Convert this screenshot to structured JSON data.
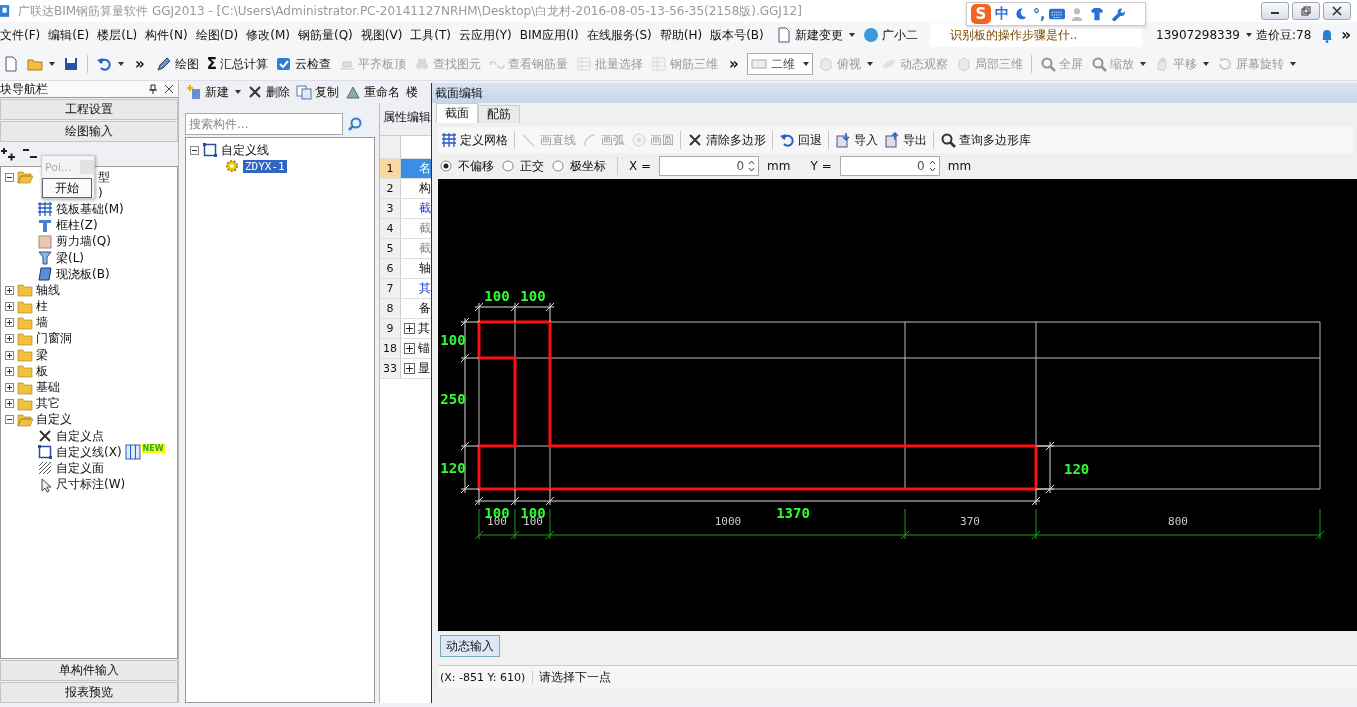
{
  "window": {
    "title": "广联达BIM钢筋算量软件 GGJ2013 - [C:\\Users\\Administrator.PC-20141127NRHM\\Desktop\\白龙村-2016-08-05-13-56-35(2158版).GGJ12]"
  },
  "ime": {
    "logo": "S",
    "lang": "中",
    "punct": "°,"
  },
  "menu": [
    "文件(F)",
    "编辑(E)",
    "楼层(L)",
    "构件(N)",
    "绘图(D)",
    "修改(M)",
    "钢筋量(Q)",
    "视图(V)",
    "工具(T)",
    "云应用(Y)",
    "BIM应用(I)",
    "在线服务(S)",
    "帮助(H)",
    "版本号(B)"
  ],
  "menu_extras": {
    "change": "新建变更",
    "assistant": "广小二",
    "hint": "识别板的操作步骤是什..",
    "phone": "13907298339",
    "beans": "造价豆:78",
    "more": "»"
  },
  "toolbar": [
    {
      "kind": "button",
      "disabled": false,
      "dropdown": false
    },
    {
      "kind": "button",
      "disabled": false,
      "dropdown": true
    },
    {
      "kind": "button",
      "disabled": false,
      "dropdown": false
    },
    {
      "kind": "separator"
    },
    {
      "kind": "button",
      "disabled": false,
      "dropdown": true
    },
    {
      "kind": "chevron",
      "label": "»"
    },
    {
      "kind": "button",
      "label": "绘图",
      "disabled": false,
      "dropdown": false
    },
    {
      "kind": "button",
      "glyph": "Σ",
      "label": "汇总计算",
      "disabled": false,
      "dropdown": false
    },
    {
      "kind": "button",
      "label": "云检查",
      "disabled": false,
      "dropdown": false
    },
    {
      "kind": "button",
      "label": "平齐板顶",
      "disabled": true,
      "dropdown": false
    },
    {
      "kind": "button",
      "label": "查找图元",
      "disabled": true,
      "dropdown": false
    },
    {
      "kind": "button",
      "label": "查看钢筋量",
      "disabled": true,
      "dropdown": false
    },
    {
      "kind": "button",
      "label": "批量选择",
      "disabled": true,
      "dropdown": false
    },
    {
      "kind": "button",
      "label": "钢筋三维",
      "disabled": true,
      "dropdown": false
    },
    {
      "kind": "chevron",
      "label": "»"
    },
    {
      "kind": "select",
      "label": "二维"
    },
    {
      "kind": "button",
      "label": "俯视",
      "disabled": true,
      "dropdown": true
    },
    {
      "kind": "button",
      "label": "动态观察",
      "disabled": true,
      "dropdown": false
    },
    {
      "kind": "button",
      "label": "局部三维",
      "disabled": true,
      "dropdown": false
    },
    {
      "kind": "separator"
    },
    {
      "kind": "button",
      "label": "全屏",
      "disabled": true,
      "dropdown": false
    },
    {
      "kind": "button",
      "label": "缩放",
      "disabled": true,
      "dropdown": true
    },
    {
      "kind": "button",
      "label": "平移",
      "disabled": true,
      "dropdown": true
    },
    {
      "kind": "button",
      "label": "屏幕旋转",
      "disabled": true,
      "dropdown": true
    }
  ],
  "nav": {
    "title": "块导航栏",
    "sections_top": [
      "工程设置",
      "绘图输入"
    ],
    "sections_bottom": [
      "单构件输入",
      "报表预览"
    ],
    "popup": {
      "title": "Poi...",
      "button": "开始"
    },
    "tree": [
      {
        "label": "型",
        "expanded": true,
        "children": [
          {
            "label": ")"
          },
          {
            "label": "筏板基础(M)"
          },
          {
            "label": "框柱(Z)"
          },
          {
            "label": "剪力墙(Q)"
          },
          {
            "label": "梁(L)"
          },
          {
            "label": "现浇板(B)"
          }
        ]
      },
      {
        "label": "轴线",
        "expanded": false
      },
      {
        "label": "柱",
        "expanded": false
      },
      {
        "label": "墙",
        "expanded": false
      },
      {
        "label": "门窗洞",
        "expanded": false
      },
      {
        "label": "梁",
        "expanded": false
      },
      {
        "label": "板",
        "expanded": false
      },
      {
        "label": "基础",
        "expanded": false
      },
      {
        "label": "其它",
        "expanded": false
      },
      {
        "label": "自定义",
        "expanded": true,
        "children": [
          {
            "label": "自定义点"
          },
          {
            "label": "自定义线(X)",
            "badge": "NEW"
          },
          {
            "label": "自定义面"
          },
          {
            "label": "尺寸标注(W)"
          }
        ]
      }
    ]
  },
  "components": {
    "toolbar": [
      {
        "label": "新建",
        "dropdown": true
      },
      {
        "label": "删除",
        "dropdown": false
      },
      {
        "label": "复制",
        "dropdown": false
      },
      {
        "label": "重命名",
        "dropdown": false
      },
      {
        "label": "楼",
        "dropdown": false
      }
    ],
    "search": {
      "placeholder": "搜索构件..."
    },
    "tree": [
      {
        "label": "自定义线",
        "expanded": true,
        "children": [
          {
            "label": "ZDYX-1",
            "selected": true
          }
        ]
      }
    ]
  },
  "properties": {
    "tab": "属性编辑",
    "rows": [
      {
        "num": "1",
        "text": "名",
        "kind": "plain",
        "expandable": false,
        "selected": true
      },
      {
        "num": "2",
        "text": "构",
        "kind": "plain",
        "expandable": false,
        "selected": false
      },
      {
        "num": "3",
        "text": "截",
        "kind": "link",
        "expandable": false,
        "selected": false
      },
      {
        "num": "4",
        "text": "截",
        "kind": "muted",
        "expandable": false,
        "selected": false
      },
      {
        "num": "5",
        "text": "截",
        "kind": "muted",
        "expandable": false,
        "selected": false
      },
      {
        "num": "6",
        "text": "轴",
        "kind": "plain",
        "expandable": false,
        "selected": false
      },
      {
        "num": "7",
        "text": "其",
        "kind": "link",
        "expandable": false,
        "selected": false
      },
      {
        "num": "8",
        "text": "备",
        "kind": "plain",
        "expandable": false,
        "selected": false
      },
      {
        "num": "9",
        "text": "其",
        "kind": "plain",
        "expandable": true,
        "selected": false
      },
      {
        "num": "18",
        "text": "锚",
        "kind": "plain",
        "expandable": true,
        "selected": false
      },
      {
        "num": "33",
        "text": "显",
        "kind": "plain",
        "expandable": true,
        "selected": false
      }
    ]
  },
  "dialog": {
    "title": "截面编辑",
    "tabs": [
      {
        "label": "截面",
        "selected": true
      },
      {
        "label": "配筋",
        "selected": false
      }
    ],
    "tools": [
      {
        "label": "定义网格",
        "disabled": false
      },
      {
        "label": "画直线",
        "disabled": true
      },
      {
        "label": "画弧",
        "disabled": true
      },
      {
        "label": "画圆",
        "disabled": true
      },
      {
        "label": "清除多边形",
        "disabled": false
      },
      {
        "label": "回退",
        "disabled": false
      },
      {
        "label": "导入",
        "disabled": false
      },
      {
        "label": "导出",
        "disabled": false
      },
      {
        "label": "查询多边形库",
        "disabled": false
      }
    ],
    "modes": [
      {
        "label": "不偏移",
        "selected": true
      },
      {
        "label": "正交",
        "selected": false
      },
      {
        "label": "极坐标",
        "selected": false
      }
    ],
    "coords": [
      {
        "label": "X =",
        "value": "0",
        "unit": "mm"
      },
      {
        "label": "Y =",
        "value": "0",
        "unit": "mm"
      }
    ],
    "canvas": {
      "top_dims": [
        "100",
        "100"
      ],
      "left_dims": [
        "100",
        "250",
        "120"
      ],
      "right_dims": [
        "120"
      ],
      "bottom_dims": [
        "100",
        "100",
        "1370"
      ],
      "grid_labels": [
        "100",
        "100",
        "1000",
        "370",
        "800"
      ]
    },
    "dynamic_button": "动态输入",
    "status": {
      "coords": "(X: -851 Y: 610)",
      "prompt": "请选择下一点"
    }
  }
}
